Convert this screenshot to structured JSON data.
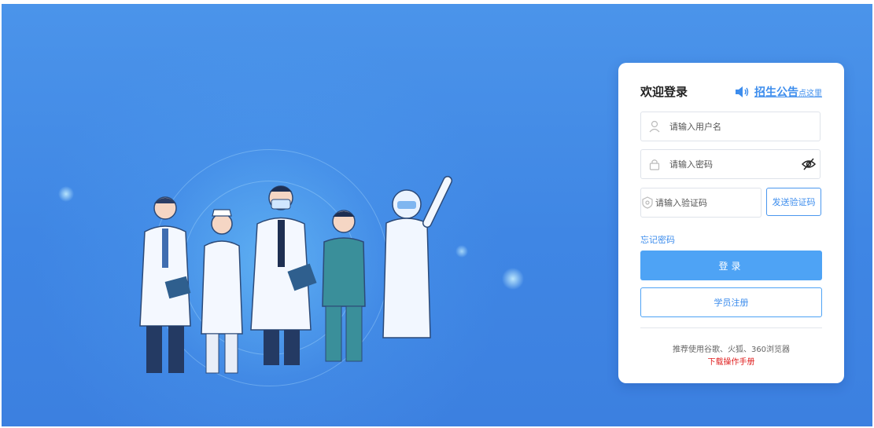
{
  "login": {
    "welcome": "欢迎登录",
    "notice_main": "招生公告",
    "notice_sub": "点这里",
    "username_placeholder": "请输入用户名",
    "password_placeholder": "请输入密码",
    "captcha_placeholder": "请输入验证码",
    "send_code_label": "发送验证码",
    "forgot_label": "忘记密码",
    "login_label": "登录",
    "register_label": "学员注册",
    "browser_tip": "推荐使用谷歌、火狐、360浏览器",
    "manual_label": "下载操作手册"
  },
  "colors": {
    "accent": "#3d8ded",
    "button": "#4ea3f5",
    "alert": "#e02020",
    "background": "#4289e6"
  },
  "icons": [
    "user-icon",
    "lock-icon",
    "shield-icon",
    "eye-off-icon",
    "speaker-icon"
  ]
}
